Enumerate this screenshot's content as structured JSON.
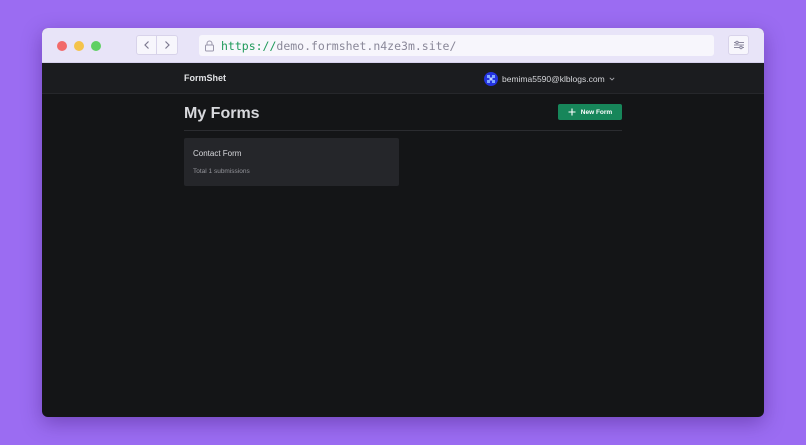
{
  "browser": {
    "url_scheme": "https://",
    "url_rest": "demo.formshet.n4ze3m.site/"
  },
  "app": {
    "brand": "FormShet",
    "user_email": "bemima5590@klblogs.com"
  },
  "main": {
    "title": "My Forms",
    "new_form_label": "New Form",
    "forms": [
      {
        "name": "Contact Form",
        "submissions": "Total 1 submissions"
      }
    ]
  },
  "colors": {
    "background": "#9b6cf2",
    "accent": "#17865a",
    "app_bg": "#141517"
  },
  "icons": [
    "back-icon",
    "forward-icon",
    "lock-icon",
    "tune-icon",
    "avatar-icon",
    "chevron-down-icon",
    "plus-icon"
  ]
}
